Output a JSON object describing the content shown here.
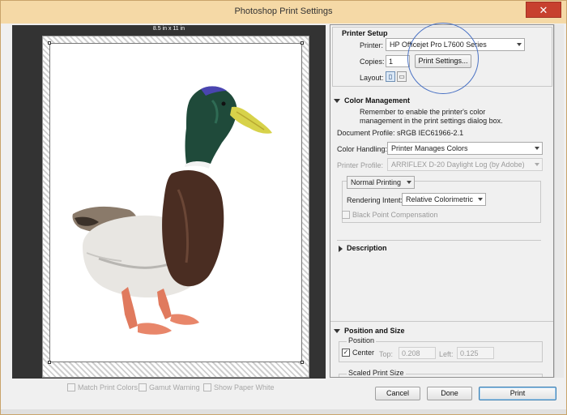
{
  "window": {
    "title": "Photoshop Print Settings",
    "close_glyph": "✕"
  },
  "preview": {
    "paper_size": "8.5 in x 11 in",
    "match_print_colors": "Match Print Colors",
    "gamut_warning": "Gamut Warning",
    "show_paper_white": "Show Paper White"
  },
  "printer_setup": {
    "title": "Printer Setup",
    "printer_label": "Printer:",
    "printer_value": "HP Officejet Pro L7600 Series",
    "copies_label": "Copies:",
    "copies_value": "1",
    "print_settings_btn": "Print Settings...",
    "layout_label": "Layout:"
  },
  "color_management": {
    "title": "Color Management",
    "reminder": "Remember to enable the printer's color management in the print settings dialog box.",
    "doc_profile": "Document Profile: sRGB IEC61966-2.1",
    "color_handling_label": "Color Handling:",
    "color_handling_value": "Printer Manages Colors",
    "printer_profile_label": "Printer Profile:",
    "printer_profile_value": "ARRIFLEX D-20 Daylight Log (by Adobe)",
    "normal_printing": "Normal Printing",
    "rendering_intent_label": "Rendering Intent:",
    "rendering_intent_value": "Relative Colorimetric",
    "black_point": "Black Point Compensation"
  },
  "description": {
    "title": "Description"
  },
  "position_size": {
    "title": "Position and Size",
    "position_group": "Position",
    "center_label": "Center",
    "top_label": "Top:",
    "top_value": "0.208",
    "left_label": "Left:",
    "left_value": "0.125",
    "scaled_group": "Scaled Print Size"
  },
  "footer": {
    "cancel": "Cancel",
    "done": "Done",
    "print": "Print"
  },
  "colors": {
    "accent_circle": "#4a72c4",
    "close": "#c7402f",
    "titlebar": "#f5d9a6"
  }
}
